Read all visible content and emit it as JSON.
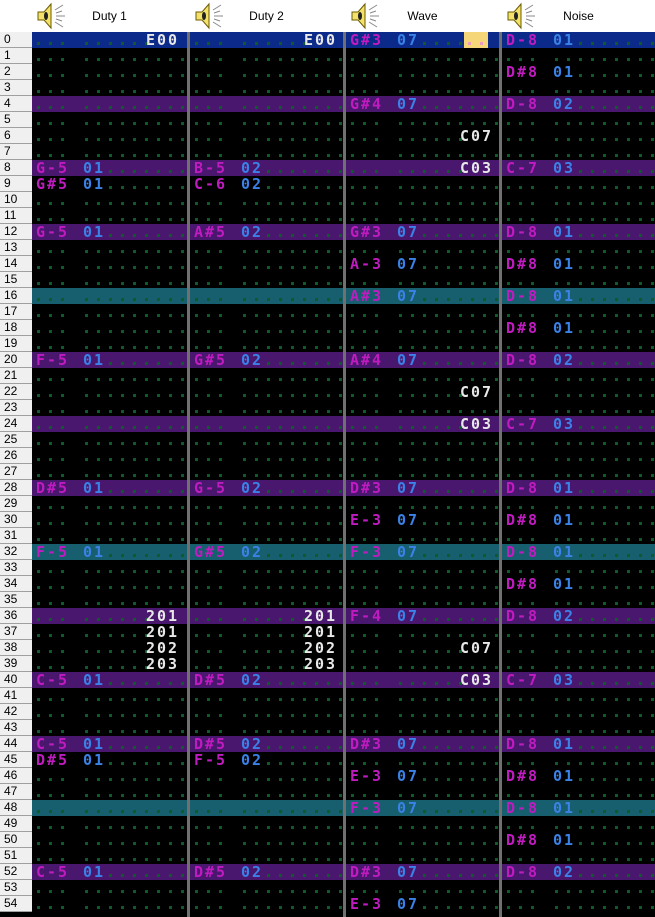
{
  "channels": [
    {
      "name": "Duty 1",
      "icon": "speaker-icon"
    },
    {
      "name": "Duty 2",
      "icon": "speaker-icon"
    },
    {
      "name": "Wave",
      "icon": "speaker-icon"
    },
    {
      "name": "Noise",
      "icon": "speaker-icon"
    }
  ],
  "row_count": 55,
  "highlight_every": 4,
  "highlight_major_every": 16,
  "cursor": {
    "row": 0,
    "channel": 2,
    "field": "effect"
  },
  "colors": {
    "note": "#c01bc0",
    "instrument": "#3a82e8",
    "effect": "#e8e8e8",
    "row_highlight": "#4a176e",
    "row_highlight_major": "#175e6e",
    "cursor_row": "#0c2a8a",
    "cursor_cell": "#f5d77a"
  },
  "pattern": {
    "0": [
      {
        "fx": "E00"
      },
      {
        "fx": "E00"
      },
      {
        "note": "G#3",
        "inst": "07"
      },
      {
        "note": "D-8",
        "inst": "01"
      }
    ],
    "2": [
      {},
      {},
      {},
      {
        "note": "D#8",
        "inst": "01"
      }
    ],
    "4": [
      {},
      {},
      {
        "note": "G#4",
        "inst": "07"
      },
      {
        "note": "D-8",
        "inst": "02"
      }
    ],
    "6": [
      {},
      {},
      {
        "fx": "C07"
      },
      {}
    ],
    "8": [
      {
        "note": "G-5",
        "inst": "01"
      },
      {
        "note": "B-5",
        "inst": "02"
      },
      {
        "fx": "C03"
      },
      {
        "note": "C-7",
        "inst": "03"
      }
    ],
    "9": [
      {
        "note": "G#5",
        "inst": "01"
      },
      {
        "note": "C-6",
        "inst": "02"
      },
      {},
      {}
    ],
    "12": [
      {
        "note": "G-5",
        "inst": "01"
      },
      {
        "note": "A#5",
        "inst": "02"
      },
      {
        "note": "G#3",
        "inst": "07"
      },
      {
        "note": "D-8",
        "inst": "01"
      }
    ],
    "14": [
      {},
      {},
      {
        "note": "A-3",
        "inst": "07"
      },
      {
        "note": "D#8",
        "inst": "01"
      }
    ],
    "16": [
      {},
      {},
      {
        "note": "A#3",
        "inst": "07"
      },
      {
        "note": "D-8",
        "inst": "01"
      }
    ],
    "18": [
      {},
      {},
      {},
      {
        "note": "D#8",
        "inst": "01"
      }
    ],
    "20": [
      {
        "note": "F-5",
        "inst": "01"
      },
      {
        "note": "G#5",
        "inst": "02"
      },
      {
        "note": "A#4",
        "inst": "07"
      },
      {
        "note": "D-8",
        "inst": "02"
      }
    ],
    "22": [
      {},
      {},
      {
        "fx": "C07"
      },
      {}
    ],
    "24": [
      {},
      {},
      {
        "fx": "C03"
      },
      {
        "note": "C-7",
        "inst": "03"
      }
    ],
    "28": [
      {
        "note": "D#5",
        "inst": "01"
      },
      {
        "note": "G-5",
        "inst": "02"
      },
      {
        "note": "D#3",
        "inst": "07"
      },
      {
        "note": "D-8",
        "inst": "01"
      }
    ],
    "30": [
      {},
      {},
      {
        "note": "E-3",
        "inst": "07"
      },
      {
        "note": "D#8",
        "inst": "01"
      }
    ],
    "32": [
      {
        "note": "F-5",
        "inst": "01"
      },
      {
        "note": "G#5",
        "inst": "02"
      },
      {
        "note": "F-3",
        "inst": "07"
      },
      {
        "note": "D-8",
        "inst": "01"
      }
    ],
    "34": [
      {},
      {},
      {},
      {
        "note": "D#8",
        "inst": "01"
      }
    ],
    "36": [
      {
        "fx": "201"
      },
      {
        "fx": "201"
      },
      {
        "note": "F-4",
        "inst": "07"
      },
      {
        "note": "D-8",
        "inst": "02"
      }
    ],
    "37": [
      {
        "fx": "201"
      },
      {
        "fx": "201"
      },
      {},
      {}
    ],
    "38": [
      {
        "fx": "202"
      },
      {
        "fx": "202"
      },
      {
        "fx": "C07"
      },
      {}
    ],
    "39": [
      {
        "fx": "203"
      },
      {
        "fx": "203"
      },
      {},
      {}
    ],
    "40": [
      {
        "note": "C-5",
        "inst": "01"
      },
      {
        "note": "D#5",
        "inst": "02"
      },
      {
        "fx": "C03"
      },
      {
        "note": "C-7",
        "inst": "03"
      }
    ],
    "44": [
      {
        "note": "C-5",
        "inst": "01"
      },
      {
        "note": "D#5",
        "inst": "02"
      },
      {
        "note": "D#3",
        "inst": "07"
      },
      {
        "note": "D-8",
        "inst": "01"
      }
    ],
    "45": [
      {
        "note": "D#5",
        "inst": "01"
      },
      {
        "note": "F-5",
        "inst": "02"
      },
      {},
      {}
    ],
    "46": [
      {},
      {},
      {
        "note": "E-3",
        "inst": "07"
      },
      {
        "note": "D#8",
        "inst": "01"
      }
    ],
    "48": [
      {},
      {},
      {
        "note": "F-3",
        "inst": "07"
      },
      {
        "note": "D-8",
        "inst": "01"
      }
    ],
    "50": [
      {},
      {},
      {},
      {
        "note": "D#8",
        "inst": "01"
      }
    ],
    "52": [
      {
        "note": "C-5",
        "inst": "01"
      },
      {
        "note": "D#5",
        "inst": "02"
      },
      {
        "note": "D#3",
        "inst": "07"
      },
      {
        "note": "D-8",
        "inst": "02"
      }
    ],
    "54": [
      {},
      {},
      {
        "note": "E-3",
        "inst": "07"
      },
      {}
    ]
  }
}
